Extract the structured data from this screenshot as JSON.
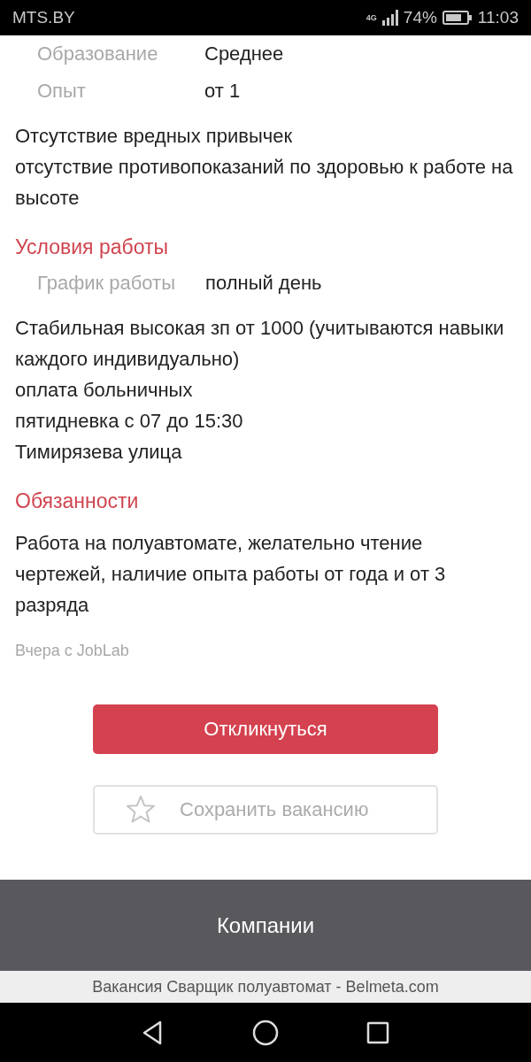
{
  "status_bar": {
    "carrier": "MTS.BY",
    "network": "4G",
    "battery": "74%",
    "time": "11:03"
  },
  "blocks": [
    {
      "kind": "field",
      "label": "Образование",
      "value": "Среднее"
    },
    {
      "kind": "field",
      "label": "Опыт",
      "value": "от 1"
    },
    {
      "kind": "paragraph",
      "lines": [
        "Отсутствие вредных привычек",
        "отсутствие противопоказаний по здоровью к работе на высоте"
      ]
    },
    {
      "kind": "heading",
      "text": "Условия работы"
    },
    {
      "kind": "field",
      "label": "График работы",
      "value": "полный день"
    },
    {
      "kind": "paragraph",
      "lines": [
        "Стабильная высокая зп от 1000 (учитываются навыки каждого индивидуально)",
        "оплата больничных",
        "пятидневка с 07 до 15:30",
        "Тимирязева улица"
      ]
    },
    {
      "kind": "heading",
      "text": "Обязанности"
    },
    {
      "kind": "paragraph",
      "lines": [
        "Работа на полуавтомате, желательно чтение чертежей, наличие опыта работы от года и от 3 разряда"
      ]
    },
    {
      "kind": "source",
      "text": "Вчера с JobLab"
    }
  ],
  "apply_button": "Откликнуться",
  "save_button": "Сохранить вакансию",
  "companies_bar": "Компании",
  "page_title": "Вакансия Сварщик полуавтомат - Belmeta.com"
}
